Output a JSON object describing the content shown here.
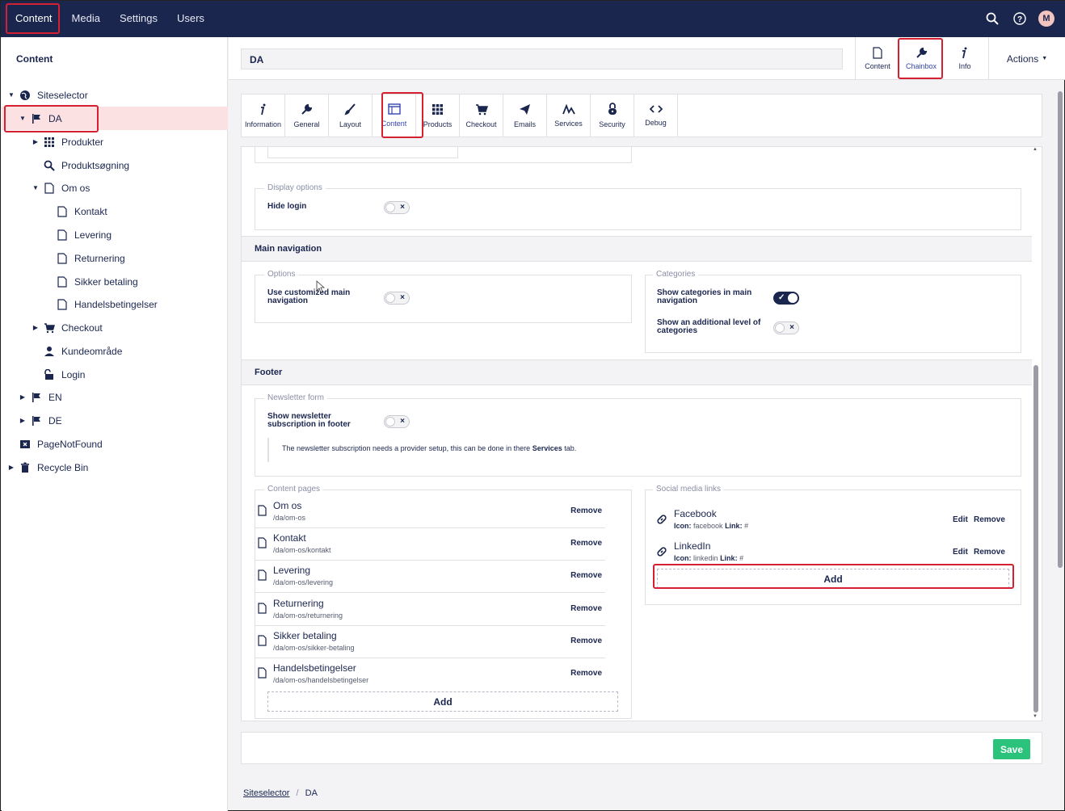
{
  "topnav": {
    "items": [
      "Content",
      "Media",
      "Settings",
      "Users"
    ],
    "avatar_initial": "M"
  },
  "sidebar": {
    "title": "Content",
    "tree": [
      {
        "label": "Siteselector",
        "icon": "globe-icon"
      },
      {
        "label": "DA",
        "icon": "flag-icon"
      },
      {
        "label": "Produkter",
        "icon": "grid-icon"
      },
      {
        "label": "Produktsøgning",
        "icon": "search-icon"
      },
      {
        "label": "Om os",
        "icon": "document-icon"
      },
      {
        "label": "Kontakt",
        "icon": "document-icon"
      },
      {
        "label": "Levering",
        "icon": "document-icon"
      },
      {
        "label": "Returnering",
        "icon": "document-icon"
      },
      {
        "label": "Sikker betaling",
        "icon": "document-icon"
      },
      {
        "label": "Handelsbetingelser",
        "icon": "document-icon"
      },
      {
        "label": "Checkout",
        "icon": "cart-icon"
      },
      {
        "label": "Kundeområde",
        "icon": "user-icon"
      },
      {
        "label": "Login",
        "icon": "unlock-icon"
      },
      {
        "label": "EN",
        "icon": "flag-icon"
      },
      {
        "label": "DE",
        "icon": "flag-icon"
      },
      {
        "label": "PageNotFound",
        "icon": "page-not-found-icon"
      },
      {
        "label": "Recycle Bin",
        "icon": "trash-icon"
      }
    ]
  },
  "header": {
    "node_name": "DA",
    "apps": [
      "Content",
      "Chainbox",
      "Info"
    ],
    "actions_label": "Actions"
  },
  "tabs": [
    "Information",
    "General",
    "Layout",
    "Content",
    "Products",
    "Checkout",
    "Emails",
    "Services",
    "Security",
    "Debug"
  ],
  "display_options": {
    "legend": "Display options",
    "hide_login_label": "Hide login"
  },
  "main_navigation": {
    "heading": "Main navigation",
    "options_legend": "Options",
    "use_customized_label": "Use customized main navigation",
    "categories_legend": "Categories",
    "show_categories_label": "Show categories in main navigation",
    "show_additional_label": "Show an additional level of categories"
  },
  "footer": {
    "heading": "Footer",
    "newsletter_legend": "Newsletter form",
    "show_newsletter_label": "Show newsletter subscription in footer",
    "info_text": "The newsletter subscription needs a provider setup, this can be done in there",
    "info_bold": "Services",
    "info_tail": "tab.",
    "content_pages_legend": "Content pages",
    "content_pages": [
      {
        "name": "Om os",
        "path": "/da/om-os"
      },
      {
        "name": "Kontakt",
        "path": "/da/om-os/kontakt"
      },
      {
        "name": "Levering",
        "path": "/da/om-os/levering"
      },
      {
        "name": "Returnering",
        "path": "/da/om-os/returnering"
      },
      {
        "name": "Sikker betaling",
        "path": "/da/om-os/sikker-betaling"
      },
      {
        "name": "Handelsbetingelser",
        "path": "/da/om-os/handelsbetingelser"
      }
    ],
    "remove_label": "Remove",
    "edit_label": "Edit",
    "add_label": "Add",
    "social_legend": "Social media links",
    "icon_label": "Icon:",
    "link_label": "Link:",
    "social_links": [
      {
        "name": "Facebook",
        "icon": "facebook",
        "link": "#"
      },
      {
        "name": "LinkedIn",
        "icon": "linkedin",
        "link": "#"
      }
    ]
  },
  "save_label": "Save",
  "breadcrumb": {
    "root": "Siteselector",
    "sep": "/",
    "current": "DA"
  },
  "colors": {
    "nav": "#1b264f",
    "accent": "#3544b1",
    "save": "#2bc37c",
    "highlight": "#d42030",
    "selected_row": "#fbe1e1"
  }
}
